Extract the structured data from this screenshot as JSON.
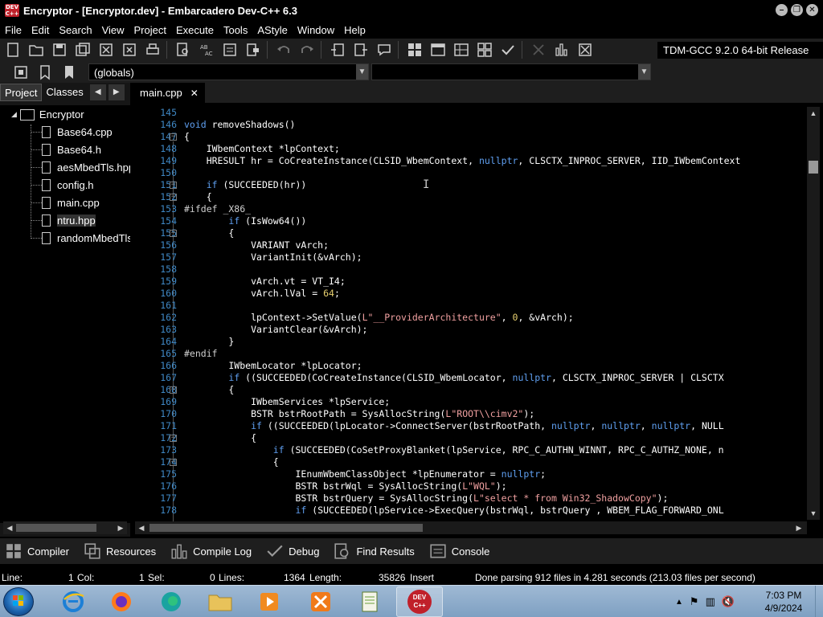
{
  "window": {
    "app_icon_text": "DEV C++",
    "title": "Encryptor - [Encryptor.dev] - Embarcadero Dev-C++ 6.3"
  },
  "menu": [
    "File",
    "Edit",
    "Search",
    "View",
    "Project",
    "Execute",
    "Tools",
    "AStyle",
    "Window",
    "Help"
  ],
  "toolbar": {
    "compiler": "TDM-GCC 9.2.0 64-bit Release",
    "scope_combo": "(globals)"
  },
  "project_panel": {
    "tabs": [
      "Project",
      "Classes"
    ],
    "root": "Encryptor",
    "files": [
      "Base64.cpp",
      "Base64.h",
      "aesMbedTls.hpp",
      "config.h",
      "main.cpp",
      "ntru.hpp",
      "randomMbedTls.hpp"
    ]
  },
  "editor": {
    "tab": "main.cpp",
    "close_glyph": "✕",
    "line_numbers": [
      "145",
      "146",
      "147",
      "148",
      "149",
      "150",
      "151",
      "152",
      "153",
      "154",
      "155",
      "156",
      "157",
      "158",
      "159",
      "160",
      "161",
      "162",
      "163",
      "164",
      "165",
      "166",
      "167",
      "168",
      "169",
      "170",
      "171",
      "172",
      "173",
      "174",
      "175",
      "176",
      "177",
      "178"
    ],
    "lines": [
      "",
      "void removeShadows()",
      "{",
      "    IWbemContext *lpContext;",
      "    HRESULT hr = CoCreateInstance(CLSID_WbemContext, nullptr, CLSCTX_INPROC_SERVER, IID_IWbemContext",
      "",
      "    if (SUCCEEDED(hr))",
      "    {",
      "#ifdef _X86_",
      "        if (IsWow64())",
      "        {",
      "            VARIANT vArch;",
      "            VariantInit(&vArch);",
      "",
      "            vArch.vt = VT_I4;",
      "            vArch.lVal = 64;",
      "",
      "            lpContext->SetValue(L\"__ProviderArchitecture\", 0, &vArch);",
      "            VariantClear(&vArch);",
      "        }",
      "#endif",
      "        IWbemLocator *lpLocator;",
      "        if ((SUCCEEDED(CoCreateInstance(CLSID_WbemLocator, nullptr, CLSCTX_INPROC_SERVER | CLSCTX",
      "        {",
      "            IWbemServices *lpService;",
      "            BSTR bstrRootPath = SysAllocString(L\"ROOT\\\\cimv2\");",
      "            if ((SUCCEEDED(lpLocator->ConnectServer(bstrRootPath, nullptr, nullptr, nullptr, NULL",
      "            {",
      "                if (SUCCEEDED(CoSetProxyBlanket(lpService, RPC_C_AUTHN_WINNT, RPC_C_AUTHZ_NONE, n",
      "                {",
      "                    IEnumWbemClassObject *lpEnumerator = nullptr;",
      "                    BSTR bstrWql = SysAllocString(L\"WQL\");",
      "                    BSTR bstrQuery = SysAllocString(L\"select * from Win32_ShadowCopy\");",
      "                    if (SUCCEEDED(lpService->ExecQuery(bstrWql, bstrQuery , WBEM_FLAG_FORWARD_ONL"
    ]
  },
  "bottom_tabs": [
    "Compiler",
    "Resources",
    "Compile Log",
    "Debug",
    "Find Results",
    "Console"
  ],
  "status": {
    "line_label": "Line:",
    "line_value": "1",
    "col_label": "Col:",
    "col_value": "1",
    "sel_label": "Sel:",
    "sel_value": "0",
    "lines_label": "Lines:",
    "lines_value": "1364",
    "length_label": "Length:",
    "length_value": "35826",
    "mode": "Insert",
    "message": "Done parsing 912 files in 4.281 seconds (213.03 files per second)"
  },
  "taskbar": {
    "time": "7:03 PM",
    "date": "4/9/2024",
    "devcpp_label": "DEV C++"
  }
}
